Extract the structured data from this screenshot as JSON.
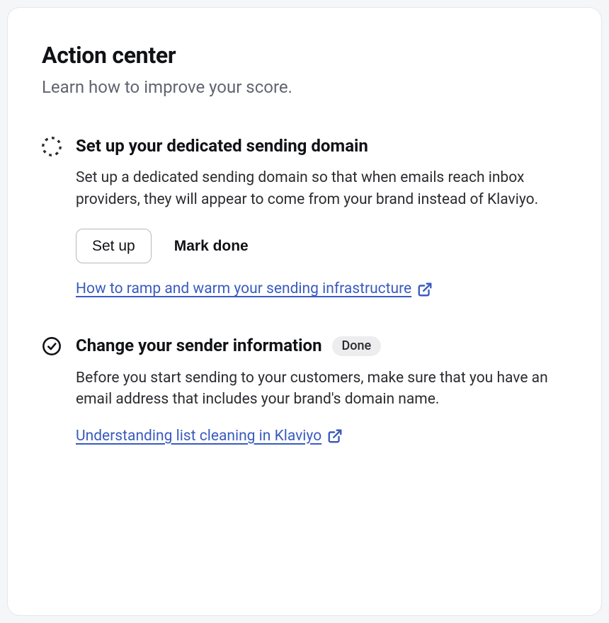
{
  "header": {
    "title": "Action center",
    "subtitle": "Learn how to improve your score."
  },
  "actions": [
    {
      "status": "pending",
      "heading": "Set up your dedicated sending domain",
      "description": "Set up a dedicated sending domain so that when emails reach inbox providers, they will appear to come from your brand instead of Klaviyo.",
      "primary_button": "Set up",
      "secondary_button": "Mark done",
      "link_text": "How to ramp and warm your sending infrastructure"
    },
    {
      "status": "done",
      "heading": "Change your sender information",
      "badge": "Done",
      "description": "Before you start sending to your customers, make sure that you have an email address that includes your brand's domain name.",
      "link_text": "Understanding list cleaning in Klaviyo"
    }
  ]
}
